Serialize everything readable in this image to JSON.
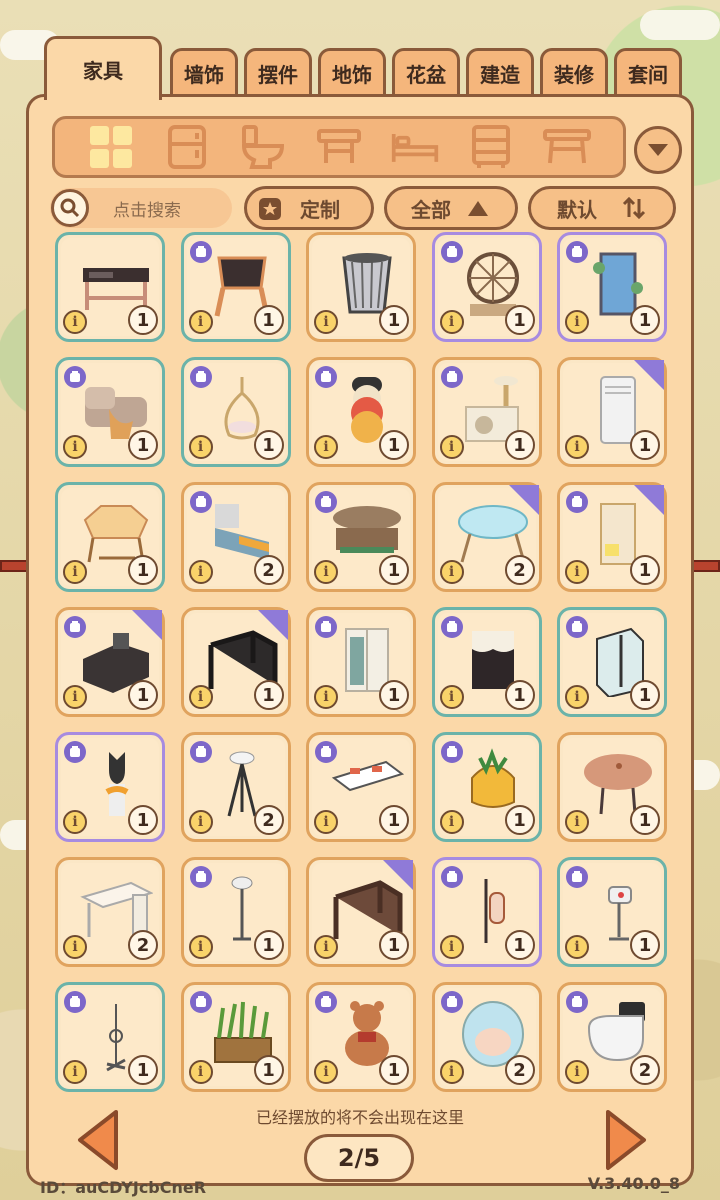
{
  "tabs": [
    {
      "label": "家具",
      "active": true
    },
    {
      "label": "墙饰"
    },
    {
      "label": "摆件"
    },
    {
      "label": "地饰"
    },
    {
      "label": "花盆"
    },
    {
      "label": "建造"
    },
    {
      "label": "装修"
    },
    {
      "label": "套间"
    }
  ],
  "category_icons": [
    "grid-icon",
    "fridge-icon",
    "toilet-icon",
    "stool-icon",
    "bed-icon",
    "cabinet-icon",
    "table-icon"
  ],
  "search": {
    "placeholder": "点击搜索"
  },
  "filters": {
    "custom_label": "定制",
    "all_label": "全部",
    "sort_label": "默认"
  },
  "items": [
    {
      "name": "desk",
      "count": "1",
      "border": "teal",
      "badge": false,
      "tri": false
    },
    {
      "name": "chair",
      "count": "1",
      "border": "teal",
      "badge": true,
      "tri": false
    },
    {
      "name": "wastebasket",
      "count": "1",
      "border": "gold",
      "badge": false,
      "tri": false
    },
    {
      "name": "ferris-wheel",
      "count": "1",
      "border": "purple",
      "badge": true,
      "tri": false
    },
    {
      "name": "waterfall-screen",
      "count": "1",
      "border": "purple",
      "badge": true,
      "tri": false
    },
    {
      "name": "sofa",
      "count": "1",
      "border": "teal",
      "badge": true,
      "tri": false
    },
    {
      "name": "hanging-chair",
      "count": "1",
      "border": "teal",
      "badge": true,
      "tri": false
    },
    {
      "name": "cake-stand",
      "count": "1",
      "border": "gold",
      "badge": true,
      "tri": false
    },
    {
      "name": "cat-tree",
      "count": "1",
      "border": "gold",
      "badge": true,
      "tri": false
    },
    {
      "name": "air-conditioner",
      "count": "1",
      "border": "gold",
      "badge": false,
      "tri": true
    },
    {
      "name": "round-table",
      "count": "1",
      "border": "teal",
      "badge": false,
      "tri": false
    },
    {
      "name": "bed",
      "count": "2",
      "border": "gold",
      "badge": true,
      "tri": false
    },
    {
      "name": "wood-shelf-table",
      "count": "1",
      "border": "gold",
      "badge": true,
      "tri": false
    },
    {
      "name": "glass-table",
      "count": "2",
      "border": "gold",
      "badge": false,
      "tri": true
    },
    {
      "name": "shelf",
      "count": "1",
      "border": "gold",
      "badge": true,
      "tri": true
    },
    {
      "name": "kitchen-counter",
      "count": "1",
      "border": "gold",
      "badge": true,
      "tri": true
    },
    {
      "name": "dark-desk",
      "count": "1",
      "border": "gold",
      "badge": false,
      "tri": true
    },
    {
      "name": "wardrobe",
      "count": "1",
      "border": "gold",
      "badge": true,
      "tri": false
    },
    {
      "name": "lace-cabinet",
      "count": "1",
      "border": "teal",
      "badge": true,
      "tri": false
    },
    {
      "name": "shower",
      "count": "1",
      "border": "teal",
      "badge": true,
      "tri": false
    },
    {
      "name": "cat-statue",
      "count": "1",
      "border": "purple",
      "badge": true,
      "tri": false
    },
    {
      "name": "floor-lamp",
      "count": "2",
      "border": "gold",
      "badge": true,
      "tri": false
    },
    {
      "name": "coffee-table",
      "count": "1",
      "border": "gold",
      "badge": true,
      "tri": false
    },
    {
      "name": "pineapple-chair",
      "count": "1",
      "border": "teal",
      "badge": true,
      "tri": false
    },
    {
      "name": "wood-table",
      "count": "1",
      "border": "gold",
      "badge": false,
      "tri": false
    },
    {
      "name": "white-desk",
      "count": "2",
      "border": "gold",
      "badge": false,
      "tri": false
    },
    {
      "name": "tall-lamp",
      "count": "1",
      "border": "gold",
      "badge": true,
      "tri": false
    },
    {
      "name": "brown-desk",
      "count": "1",
      "border": "gold",
      "badge": false,
      "tri": true
    },
    {
      "name": "lantern-stand",
      "count": "1",
      "border": "purple",
      "badge": true,
      "tri": false
    },
    {
      "name": "heater",
      "count": "1",
      "border": "teal",
      "badge": true,
      "tri": false
    },
    {
      "name": "coat-rack",
      "count": "1",
      "border": "teal",
      "badge": true,
      "tri": false
    },
    {
      "name": "planter",
      "count": "1",
      "border": "gold",
      "badge": true,
      "tri": false
    },
    {
      "name": "teddy-bear",
      "count": "1",
      "border": "gold",
      "badge": true,
      "tri": false
    },
    {
      "name": "egg-chair",
      "count": "2",
      "border": "gold",
      "badge": true,
      "tri": false
    },
    {
      "name": "smart-toilet",
      "count": "2",
      "border": "gold",
      "badge": true,
      "tri": false
    }
  ],
  "note": "已经摆放的将不会出现在这里",
  "pagination": {
    "label": "2/5",
    "current": 2,
    "total": 5
  },
  "footer": {
    "id": "ID：auCDYJcbCneR",
    "version": "V.3.40.0_8"
  },
  "colors": {
    "teal": "#6bb3a9",
    "purple": "#a78be0",
    "gold": "#e0a35e",
    "panel": "#fbd8a8",
    "outline": "#8a5a3a"
  }
}
